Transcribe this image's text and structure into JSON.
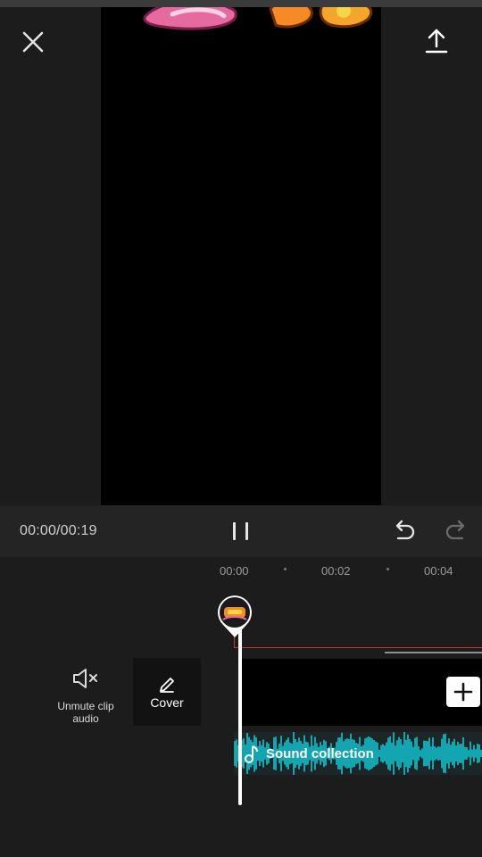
{
  "header": {
    "close_icon": "close-icon",
    "export_icon": "upload-icon"
  },
  "player": {
    "time_display": "00:00/00:19",
    "pause_icon": "pause-icon",
    "undo_icon": "undo-icon",
    "redo_icon": "redo-icon"
  },
  "timeline": {
    "ticks": [
      "00:00",
      "00:02",
      "00:04"
    ],
    "video_track_status": "playhead at start",
    "playhead_position_seconds": 0
  },
  "tools": {
    "audio_label": "Unmute clip audio",
    "cover_label": "Cover"
  },
  "audio_track": {
    "title": "Sound collection",
    "waveform_color": "#13a6b1"
  },
  "colors": {
    "background": "#1b1c1b",
    "controls_bar": "#232423",
    "accent_red": "#c7333a",
    "waveform": "#13a6b1"
  }
}
